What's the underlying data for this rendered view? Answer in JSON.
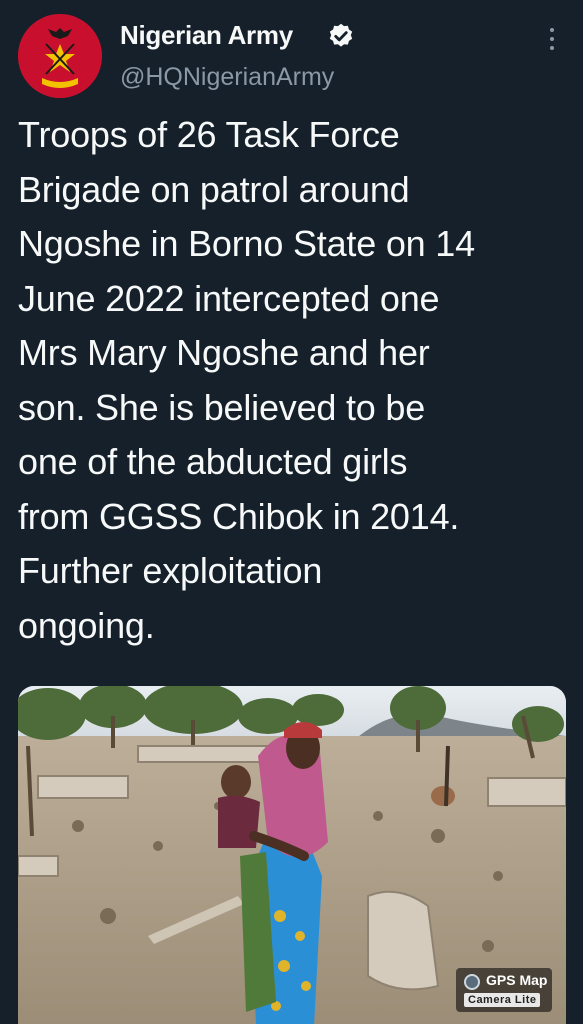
{
  "tweet": {
    "display_name": "Nigerian Army",
    "handle": "@HQNigerianArmy",
    "text": "Troops of 26 Task Force\nBrigade on patrol around\nNgoshe in Borno State on 14\nJune 2022 intercepted one\nMrs Mary Ngoshe and her\nson. She is believed to be\none of the abducted girls\nfrom GGSS Chibok in 2014.\nFurther exploitation\nongoing."
  },
  "media": {
    "watermark_title": "GPS Map",
    "watermark_subtitle": "Camera Lite"
  },
  "icons": {
    "avatar": "nigerian-army-crest",
    "verified": "verified-badge-icon",
    "more": "more-options-icon"
  },
  "colors": {
    "background": "#15202b",
    "text_primary": "#f7f9f9",
    "text_secondary": "#8b98a5",
    "avatar_red": "#c8102e"
  }
}
